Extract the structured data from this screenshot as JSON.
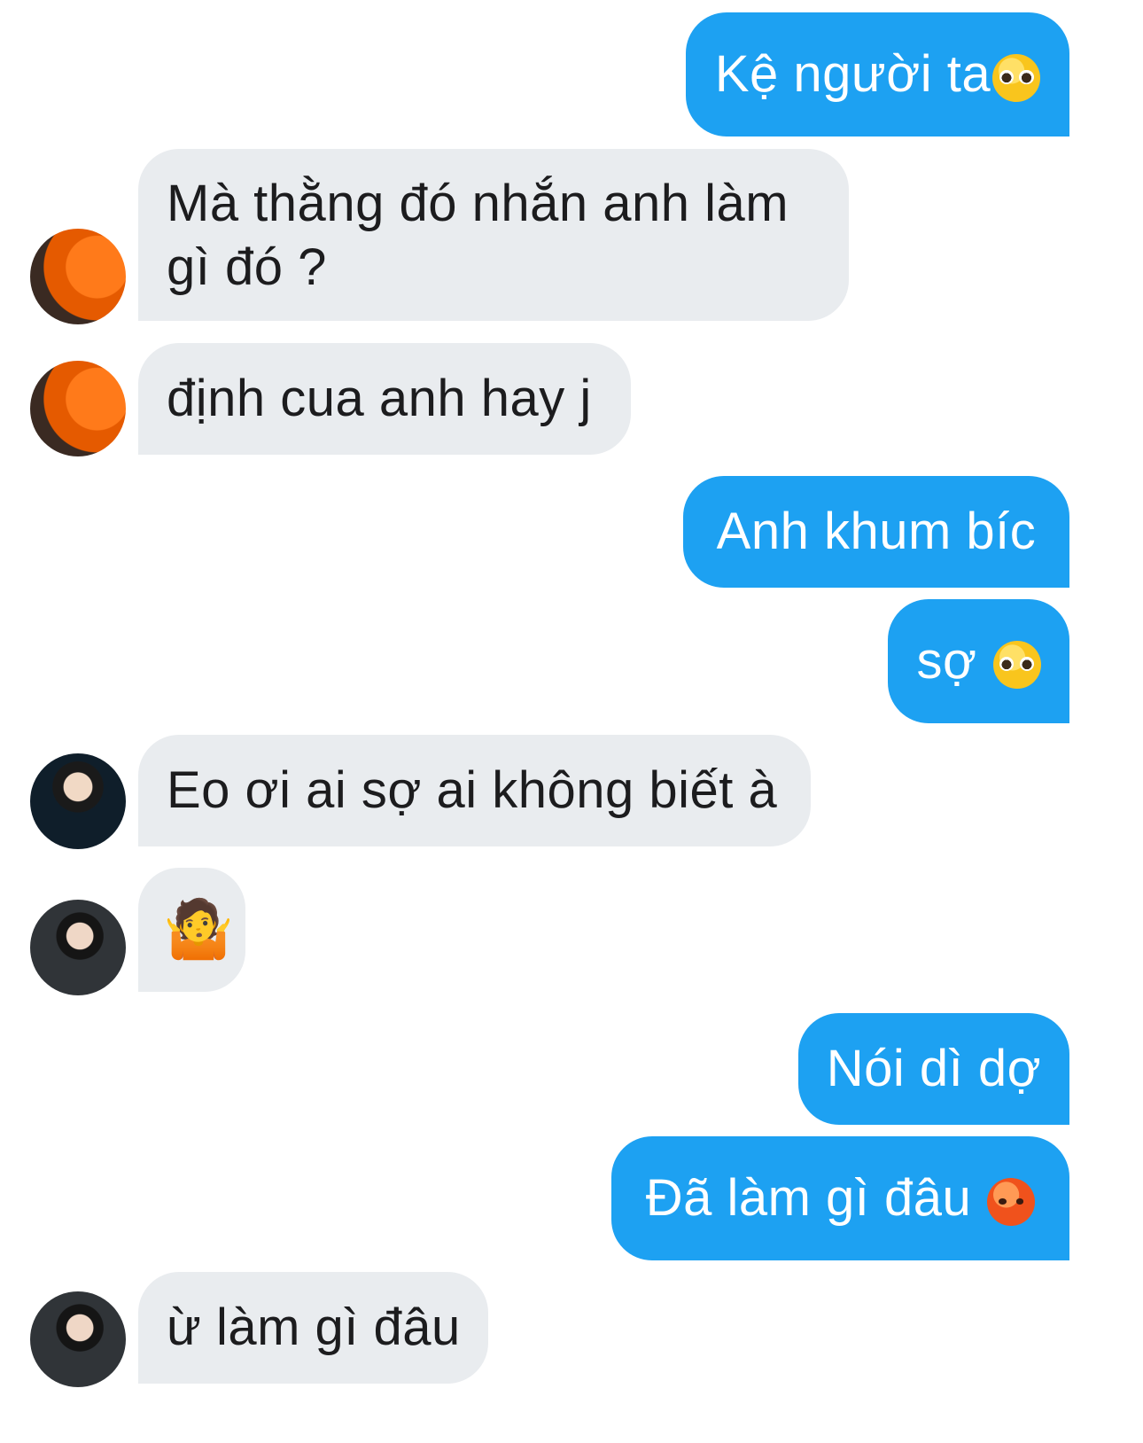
{
  "messages": [
    {
      "dir": "out",
      "text": "Kệ người ta",
      "emoji": "pleading-face-icon"
    },
    {
      "dir": "in",
      "text": "Mà thằng đó nhắn anh làm gì đó ?",
      "avatar": "avatar-orange"
    },
    {
      "dir": "in",
      "text": "định cua anh hay j",
      "avatar": "avatar-orange"
    },
    {
      "dir": "out",
      "text": "Anh khum bíc"
    },
    {
      "dir": "out",
      "text": "sợ",
      "emoji": "pleading-face-icon"
    },
    {
      "dir": "in",
      "text": "Eo ơi ai sợ ai không biết à",
      "avatar": "avatar-black-shirt"
    },
    {
      "dir": "in",
      "text": "",
      "emoji": "person-shrugging-icon",
      "avatar": "avatar-suit"
    },
    {
      "dir": "out",
      "text": "Nói dì dợ"
    },
    {
      "dir": "out",
      "text": "Đã làm gì đâu",
      "emoji": "angry-face-icon"
    },
    {
      "dir": "in",
      "text": "ừ làm gì đâu",
      "avatar": "avatar-suit"
    }
  ],
  "colors": {
    "outgoing_bubble": "#1da1f2",
    "incoming_bubble": "#e9ecef",
    "outgoing_text": "#ffffff",
    "incoming_text": "#1c1c1e"
  }
}
